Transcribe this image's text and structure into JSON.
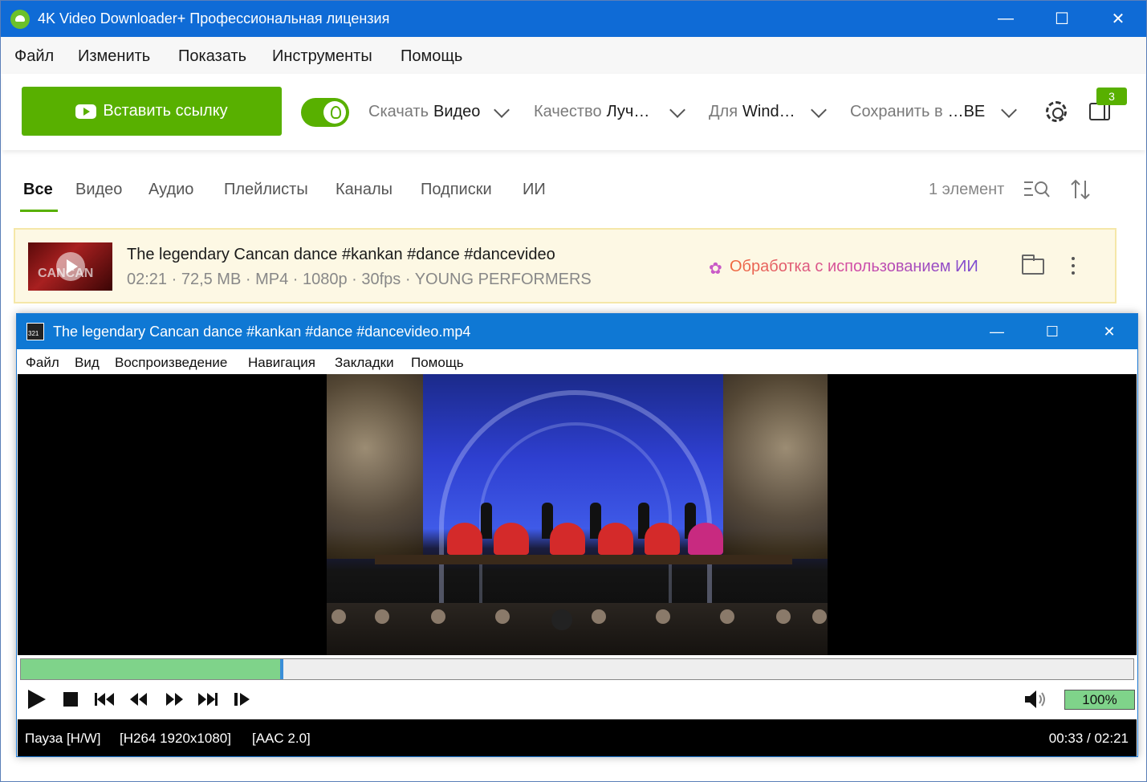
{
  "app": {
    "title": "4K Video Downloader+ Профессиональная лицензия",
    "window_controls": [
      "—",
      "☐",
      "✕"
    ]
  },
  "menu": [
    "Файл",
    "Изменить",
    "Показать",
    "Инструменты",
    "Помощь"
  ],
  "toolbar": {
    "paste_button": "Вставить ссылку",
    "smart_mode_on": true,
    "download_label": "Скачать",
    "download_value": "Видео",
    "quality_label": "Качество",
    "quality_value": "Луч…",
    "for_label": "Для",
    "for_value": "Wind…",
    "save_label": "Сохранить в",
    "save_value": "…BE",
    "queue_badge": "3"
  },
  "tabs": [
    "Все",
    "Видео",
    "Аудио",
    "Плейлисты",
    "Каналы",
    "Подписки",
    "ИИ"
  ],
  "active_tab": "Все",
  "item_count": "1 элемент",
  "download_item": {
    "thumb_text": "CANCAN",
    "title": "The legendary Cancan dance #kankan #dance #dancevideo",
    "meta": "02:21 · 72,5 MB · MP4 · 1080p · 30fps · YOUNG PERFORMERS",
    "ai_action": "Обработка с использованием ИИ"
  },
  "player": {
    "title": "The legendary Cancan dance #kankan #dance #dancevideo.mp4",
    "menu": [
      "Файл",
      "Вид",
      "Воспроизведение",
      "Навигация",
      "Закладки",
      "Помощь"
    ],
    "progress": 0.2348,
    "volume": "100%",
    "status_state": "Пауза [H/W]",
    "status_video": "[H264 1920x1080]",
    "status_audio": "[AAC 2.0]",
    "time": "00:33 / 02:21"
  },
  "colors": {
    "accent_green": "#58b000",
    "titlebar_blue": "#0f6bd6",
    "player_titlebar_blue": "#0f78d4",
    "item_highlight": "#fdf8e4"
  }
}
